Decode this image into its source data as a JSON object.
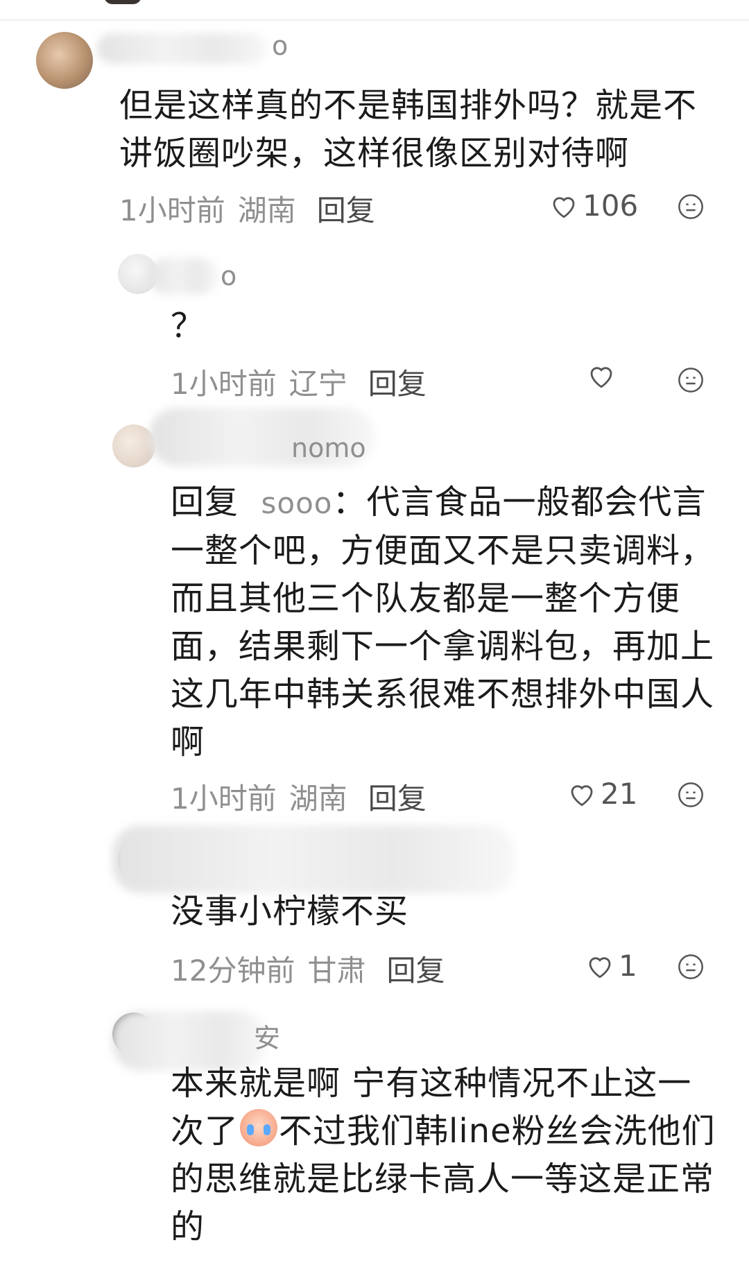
{
  "comments": [
    {
      "username_visible": "o",
      "text": "但是这样真的不是韩国排外吗？就是不讲饭圈吵架，这样很像区别对待啊",
      "time": "1小时前",
      "location": "湖南",
      "reply_label": "回复",
      "likes": "106"
    },
    {
      "username_visible": "o",
      "text": "？",
      "time": "1小时前",
      "location": "辽宁",
      "reply_label": "回复",
      "likes": ""
    },
    {
      "username_visible": "nomo",
      "reply_prefix": "回复",
      "reply_target": "sooo",
      "text": "：代言食品一般都会代言一整个吧，方便面又不是只卖调料，而且其他三个队友都是一整个方便面，结果剩下一个拿调料包，再加上这几年中韩关系很难不想排外中国人啊",
      "time": "1小时前",
      "location": "湖南",
      "reply_label": "回复",
      "likes": "21"
    },
    {
      "username_visible": "",
      "text": "没事小柠檬不买",
      "time": "12分钟前",
      "location": "甘肃",
      "reply_label": "回复",
      "likes": "1"
    },
    {
      "username_visible": "安",
      "text_part1": "本来就是啊 宁有这种情况不止这一次了",
      "text_part2": "不过我们韩line粉丝会洗他们的思维就是比绿卡高人一等这是正常的"
    }
  ]
}
